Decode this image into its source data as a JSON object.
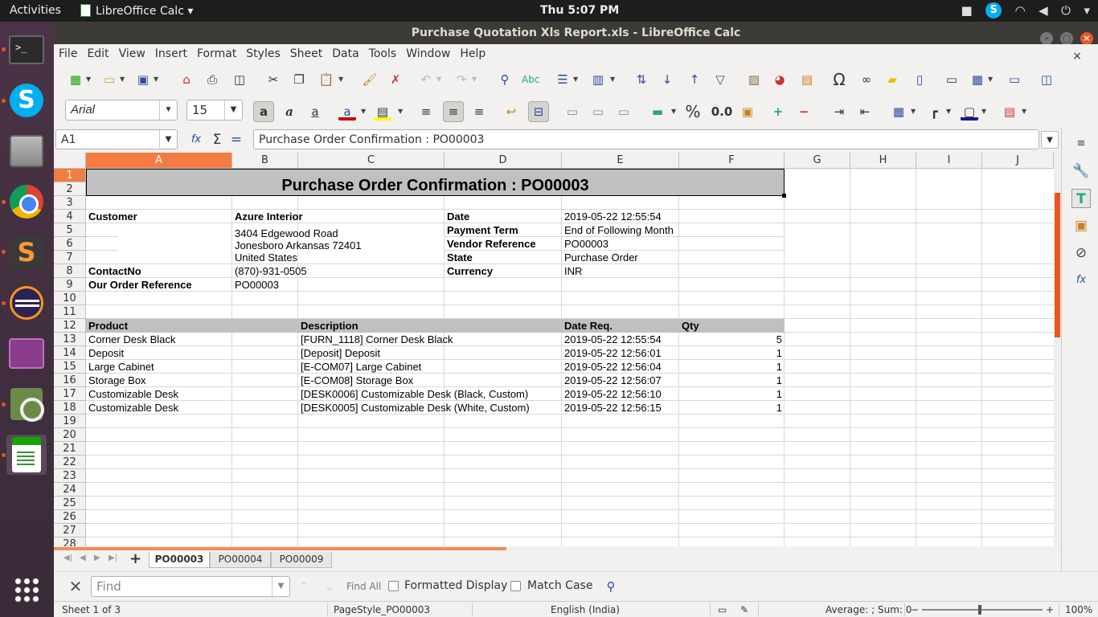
{
  "topbar": {
    "activities": "Activities",
    "app_menu": "LibreOffice Calc ▾",
    "clock": "Thu  5:07 PM"
  },
  "window": {
    "title": "Purchase Quotation Xls Report.xls - LibreOffice Calc"
  },
  "menu": [
    "File",
    "Edit",
    "View",
    "Insert",
    "Format",
    "Styles",
    "Sheet",
    "Data",
    "Tools",
    "Window",
    "Help"
  ],
  "format_bar": {
    "font_name": "Arial",
    "font_size": "15",
    "percent_label": "%",
    "number_label": "0.0"
  },
  "formula_bar": {
    "name_box": "A1",
    "content": "Purchase Order Confirmation : PO00003"
  },
  "columns": [
    "A",
    "B",
    "C",
    "D",
    "E",
    "F",
    "G",
    "H",
    "I",
    "J"
  ],
  "rows": [
    "1",
    "2",
    "3",
    "4",
    "5",
    "6",
    "7",
    "8",
    "9",
    "10",
    "11",
    "12",
    "13",
    "14",
    "15",
    "16",
    "17",
    "18",
    "19",
    "20",
    "21",
    "22",
    "23",
    "24",
    "25",
    "26",
    "27",
    "28"
  ],
  "sheet": {
    "title": "Purchase Order Confirmation : PO00003",
    "customer_label": "Customer",
    "customer_name": "Azure Interior",
    "address_line1": "3404  Edgewood Road",
    "address_line2": "Jonesboro Arkansas 72401",
    "address_line3": "United States",
    "contact_label": "ContactNo",
    "contact_value": "(870)-931-0505",
    "order_ref_label": "Our Order Reference",
    "order_ref_value": "PO00003",
    "date_label": "Date",
    "date_value": "2019-05-22 12:55:54",
    "payment_label": "Payment Term",
    "payment_value": "End of Following Month",
    "vendor_ref_label": "Vendor Reference",
    "vendor_ref_value": "PO00003",
    "state_label": "State",
    "state_value": "Purchase Order",
    "currency_label": "Currency",
    "currency_value": "INR",
    "table_headers": {
      "product": "Product",
      "description": "Description",
      "date_req": "Date Req.",
      "qty": "Qty"
    },
    "lines": [
      {
        "product": "Corner Desk Black",
        "description": "[FURN_1118] Corner Desk Black",
        "date": "2019-05-22 12:55:54",
        "qty": "5"
      },
      {
        "product": "Deposit",
        "description": "[Deposit] Deposit",
        "date": "2019-05-22 12:56:01",
        "qty": "1"
      },
      {
        "product": "Large Cabinet",
        "description": "[E-COM07] Large Cabinet",
        "date": "2019-05-22 12:56:04",
        "qty": "1"
      },
      {
        "product": "Storage Box",
        "description": "[E-COM08] Storage Box",
        "date": "2019-05-22 12:56:07",
        "qty": "1"
      },
      {
        "product": "Customizable Desk",
        "description": "[DESK0006] Customizable Desk (Black, Custom)",
        "date": "2019-05-22 12:56:10",
        "qty": "1"
      },
      {
        "product": "Customizable Desk",
        "description": "[DESK0005] Customizable Desk (White, Custom)",
        "date": "2019-05-22 12:56:15",
        "qty": "1"
      }
    ]
  },
  "tabs": [
    "PO00003",
    "PO00004",
    "PO00009"
  ],
  "find": {
    "placeholder": "Find",
    "find_all": "Find All",
    "formatted_display": "Formatted Display",
    "match_case": "Match Case"
  },
  "status": {
    "sheet": "Sheet 1 of 3",
    "page_style": "PageStyle_PO00003",
    "language": "English (India)",
    "summary": "Average: ; Sum: 0",
    "zoom": "100%"
  },
  "colors": {
    "accent": "#e95420",
    "header_gray": "#c0c0c0"
  }
}
